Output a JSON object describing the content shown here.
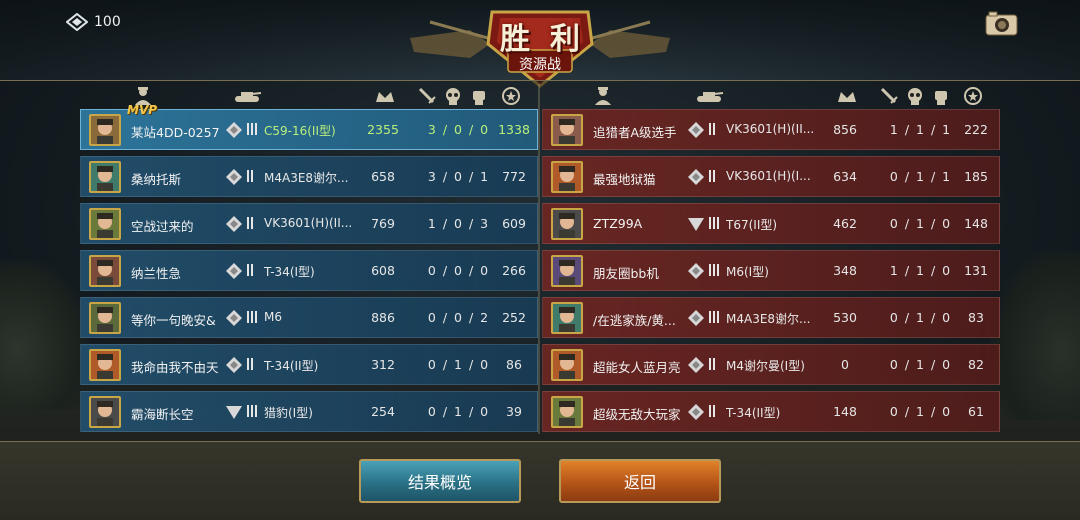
{
  "currency": {
    "value": "100",
    "icon": "diamond-icon"
  },
  "header": {
    "result": "胜利",
    "mode": "资源战",
    "camera_icon": "camera-icon"
  },
  "columns": {
    "player_icon": "commander-icon",
    "tank_icon": "tank-icon",
    "score_icon": "crown-icon",
    "kills_icon": "sword-icon",
    "deaths_icon": "skull-icon",
    "assists_icon": "fist-icon",
    "points_icon": "star-badge-icon"
  },
  "mvp_label": "MVP",
  "blue_team": [
    {
      "name": "某站4DD-0257",
      "rank": "diamond",
      "tier": 3,
      "tank": "C59-16(II型)",
      "score": "2355",
      "kda": "3 / 0 / 0",
      "points": "1338",
      "mvp": true,
      "avatar": "#8a6a3a"
    },
    {
      "name": "桑纳托斯",
      "rank": "diamond",
      "tier": 2,
      "tank": "M4A3E8谢尔...",
      "score": "658",
      "kda": "3 / 0 / 1",
      "points": "772",
      "avatar": "#3f7a6a"
    },
    {
      "name": "空战过来的",
      "rank": "diamond",
      "tier": 2,
      "tank": "VK3601(H)(II...",
      "score": "769",
      "kda": "1 / 0 / 3",
      "points": "609",
      "avatar": "#6a7a3a"
    },
    {
      "name": "纳兰性急",
      "rank": "diamond",
      "tier": 2,
      "tank": "T-34(I型)",
      "score": "608",
      "kda": "0 / 0 / 0",
      "points": "266",
      "avatar": "#7a4a3a"
    },
    {
      "name": "等你一句晚安&",
      "rank": "diamond",
      "tier": 3,
      "tank": "M6",
      "score": "886",
      "kda": "0 / 0 / 2",
      "points": "252",
      "avatar": "#5a6a3a"
    },
    {
      "name": "我命由我不由天",
      "rank": "diamond",
      "tier": 2,
      "tank": "T-34(II型)",
      "score": "312",
      "kda": "0 / 1 / 0",
      "points": "86",
      "avatar": "#b05a2a"
    },
    {
      "name": "霸海断长空",
      "rank": "triangle",
      "tier": 3,
      "tank": "猎豹(I型)",
      "score": "254",
      "kda": "0 / 1 / 0",
      "points": "39",
      "avatar": "#4a4a4a"
    }
  ],
  "red_team": [
    {
      "name": "追猎者A级选手",
      "rank": "diamond",
      "tier": 2,
      "tank": "VK3601(H)(II...",
      "score": "856",
      "kda": "1 / 1 / 1",
      "points": "222",
      "avatar": "#8a5a4a"
    },
    {
      "name": "最强地狱猫",
      "rank": "diamond",
      "tier": 2,
      "tank": "VK3601(H)(I...",
      "score": "634",
      "kda": "0 / 1 / 1",
      "points": "185",
      "avatar": "#b05a2a"
    },
    {
      "name": "ZTZ99A",
      "rank": "triangle",
      "tier": 3,
      "tank": "T67(II型)",
      "score": "462",
      "kda": "0 / 1 / 0",
      "points": "148",
      "avatar": "#4a4a4a"
    },
    {
      "name": "朋友圈bb机",
      "rank": "diamond",
      "tier": 3,
      "tank": "M6(I型)",
      "score": "348",
      "kda": "1 / 1 / 0",
      "points": "131",
      "avatar": "#5a4a7a"
    },
    {
      "name": "/在逃家族/黄...",
      "rank": "diamond",
      "tier": 3,
      "tank": "M4A3E8谢尔...",
      "score": "530",
      "kda": "0 / 1 / 0",
      "points": "83",
      "avatar": "#3f7a6a"
    },
    {
      "name": "超能女人蓝月亮",
      "rank": "diamond",
      "tier": 2,
      "tank": "M4谢尔曼(I型)",
      "score": "0",
      "kda": "0 / 1 / 0",
      "points": "82",
      "avatar": "#b05a2a"
    },
    {
      "name": "超级无敌大玩家",
      "rank": "diamond",
      "tier": 2,
      "tank": "T-34(II型)",
      "score": "148",
      "kda": "0 / 1 / 0",
      "points": "61",
      "avatar": "#6a7a3a"
    }
  ],
  "buttons": {
    "overview": "结果概览",
    "back": "返回"
  }
}
